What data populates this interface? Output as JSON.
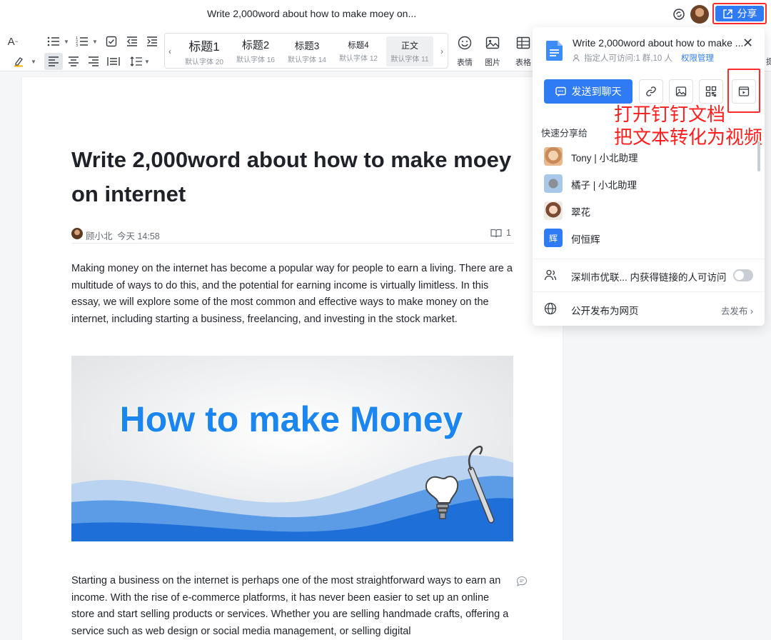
{
  "window": {
    "doc_title": "Write 2,000word about how to make moey on...",
    "share_label": "分享"
  },
  "toolbar": {
    "styles": [
      {
        "label": "标题1",
        "sub": "默认字体 20"
      },
      {
        "label": "标题2",
        "sub": "默认字体 16"
      },
      {
        "label": "标题3",
        "sub": "默认字体 14"
      },
      {
        "label": "标题4",
        "sub": "默认字体 12"
      },
      {
        "label": "正文",
        "sub": "默认字体 11"
      }
    ],
    "emoji_label": "表情",
    "image_label": "图片",
    "table_label": "表格",
    "clipped_label": "提"
  },
  "document": {
    "title": "Write 2,000word about how to make moey on internet",
    "author": "顾小北",
    "time": "今天 14:58",
    "read_count": "1",
    "paragraph1": "Making money on the internet has become a popular way for people to earn a living. There are a multitude of ways to do this, and the potential for earning income is virtually limitless. In this essay, we will explore some of the most common and effective ways to make money on the internet, including starting a business, freelancing, and investing in the stock market.",
    "image_headline": "How to make Money",
    "paragraph2": "Starting a business on the internet is perhaps one of the most straightforward ways to earn an income. With the rise of e-commerce platforms, it has never been easier to set up an online store and start selling products or services. Whether you are selling handmade crafts, offering a service such as web design or social media management, or selling digital"
  },
  "share_panel": {
    "doc_title": "Write 2,000word about how to make ...",
    "permission_text": "指定人可访问:1 群,10 人",
    "permission_link": "权限管理",
    "send_to_chat": "发送到聊天",
    "annotation_line1": "打开钉钉文档",
    "annotation_line2": "把文本转化为视频",
    "quick_share_label": "快速分享给",
    "contacts": [
      {
        "name": "Tony | 小北助理"
      },
      {
        "name": "橘子 | 小北助理"
      },
      {
        "name": "翠花"
      },
      {
        "name": "何恒辉",
        "avatar_char": "辉"
      }
    ],
    "org_access_text": "深圳市优联... 内获得链接的人可访问",
    "publish_text": "公开发布为网页",
    "publish_link": "去发布"
  },
  "colors": {
    "accent": "#2f7bf6",
    "annotation": "#ff1d1d"
  }
}
